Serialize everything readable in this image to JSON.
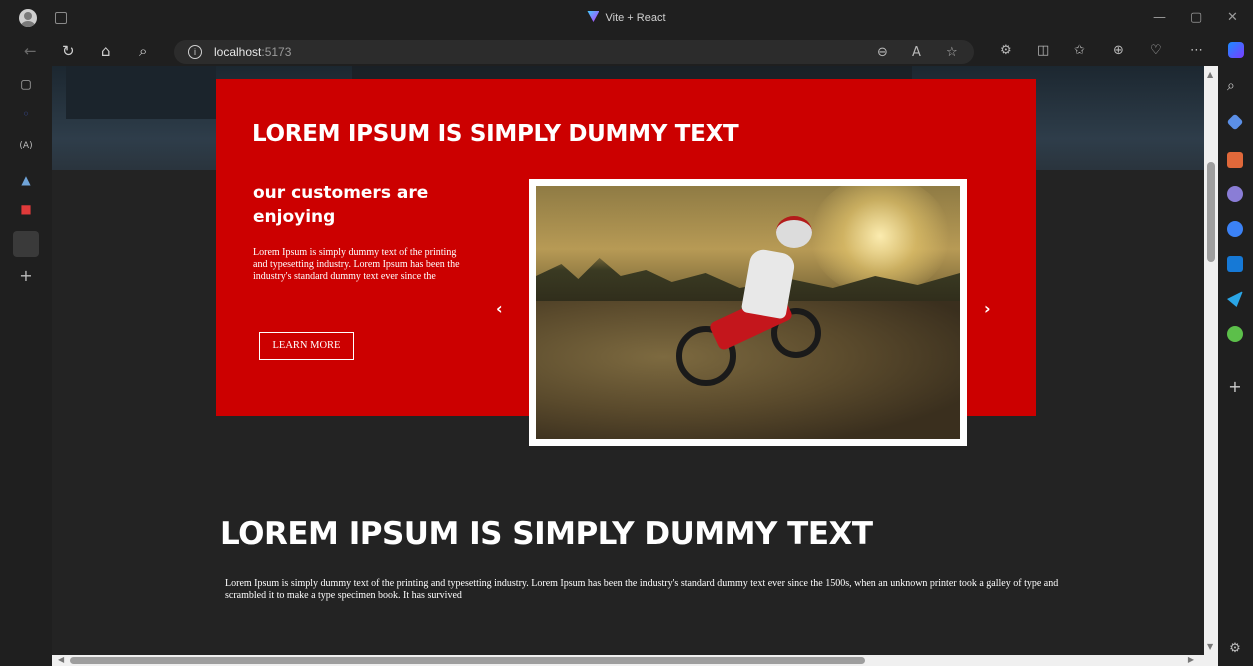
{
  "browser": {
    "tab_title": "Vite + React",
    "url_host": "localhost",
    "url_port": ":5173"
  },
  "hero": {
    "title": "LOREM IPSUM IS SIMPLY DUMMY TEXT",
    "subtitle": "our customers are enjoying",
    "body": "Lorem Ipsum is simply dummy text of the printing and typesetting industry. Lorem Ipsum has been the industry's standard dummy text ever since the",
    "button_label": "LEARN MORE",
    "prev_arrow": "‹",
    "next_arrow": "›"
  },
  "section": {
    "title": "LOREM IPSUM IS SIMPLY DUMMY TEXT",
    "body": "Lorem Ipsum is simply dummy text of the printing and typesetting industry. Lorem Ipsum has been the industry's standard dummy text ever since the 1500s, when an unknown printer took a galley of type and scrambled it to make a type specimen book. It has survived"
  },
  "colors": {
    "card_red": "#cc0000",
    "page_bg": "#232323"
  }
}
